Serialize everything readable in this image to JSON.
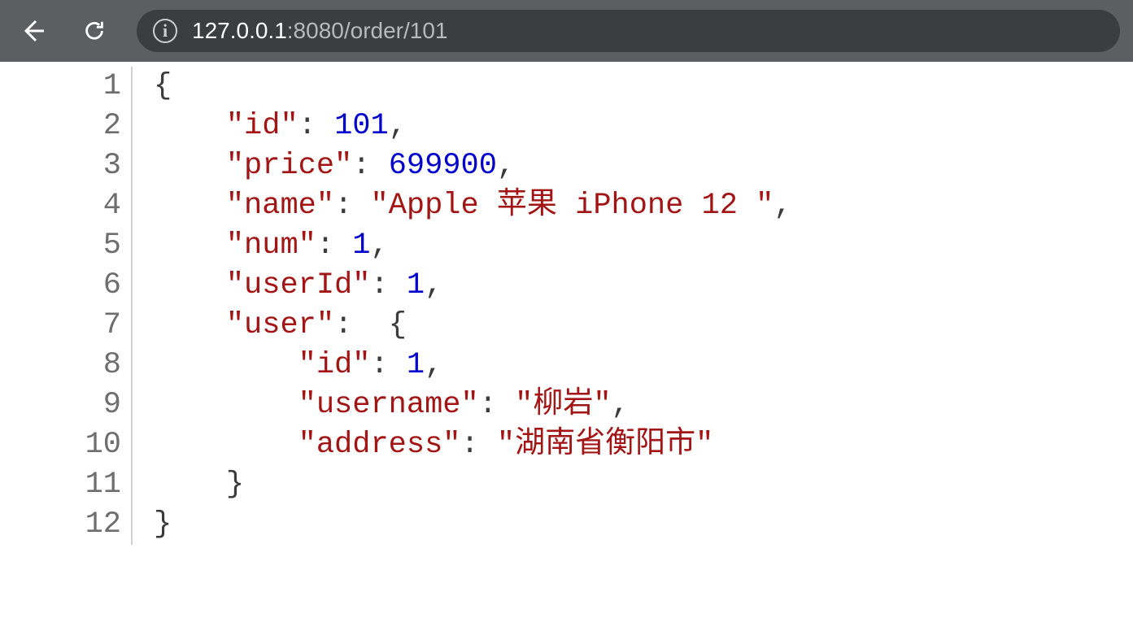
{
  "toolbar": {
    "back_label": "Back",
    "reload_label": "Reload",
    "info_label": "Site information",
    "url_host": "127.0.0.1",
    "url_port": ":8080",
    "url_path": "/order/101"
  },
  "json_body": {
    "id": 101,
    "price": 699900,
    "name": "Apple 苹果 iPhone 12 ",
    "num": 1,
    "userId": 1,
    "user": {
      "id": 1,
      "username": "柳岩",
      "address": "湖南省衡阳市"
    }
  },
  "code_lines": [
    {
      "num": "1",
      "indent": 0,
      "parts": [
        {
          "t": "p",
          "v": "{"
        }
      ]
    },
    {
      "num": "2",
      "indent": 1,
      "parts": [
        {
          "t": "k",
          "v": "\"id\""
        },
        {
          "t": "p",
          "v": ": "
        },
        {
          "t": "n",
          "v": "101"
        },
        {
          "t": "p",
          "v": ","
        }
      ]
    },
    {
      "num": "3",
      "indent": 1,
      "parts": [
        {
          "t": "k",
          "v": "\"price\""
        },
        {
          "t": "p",
          "v": ": "
        },
        {
          "t": "n",
          "v": "699900"
        },
        {
          "t": "p",
          "v": ","
        }
      ]
    },
    {
      "num": "4",
      "indent": 1,
      "parts": [
        {
          "t": "k",
          "v": "\"name\""
        },
        {
          "t": "p",
          "v": ": "
        },
        {
          "t": "k",
          "v": "\"Apple 苹果 iPhone 12 \""
        },
        {
          "t": "p",
          "v": ","
        }
      ]
    },
    {
      "num": "5",
      "indent": 1,
      "parts": [
        {
          "t": "k",
          "v": "\"num\""
        },
        {
          "t": "p",
          "v": ": "
        },
        {
          "t": "n",
          "v": "1"
        },
        {
          "t": "p",
          "v": ","
        }
      ]
    },
    {
      "num": "6",
      "indent": 1,
      "parts": [
        {
          "t": "k",
          "v": "\"userId\""
        },
        {
          "t": "p",
          "v": ": "
        },
        {
          "t": "n",
          "v": "1"
        },
        {
          "t": "p",
          "v": ","
        }
      ]
    },
    {
      "num": "7",
      "indent": 1,
      "parts": [
        {
          "t": "k",
          "v": "\"user\""
        },
        {
          "t": "p",
          "v": ": "
        },
        {
          "t": "p",
          "v": " {"
        }
      ]
    },
    {
      "num": "8",
      "indent": 2,
      "parts": [
        {
          "t": "k",
          "v": "\"id\""
        },
        {
          "t": "p",
          "v": ": "
        },
        {
          "t": "n",
          "v": "1"
        },
        {
          "t": "p",
          "v": ","
        }
      ]
    },
    {
      "num": "9",
      "indent": 2,
      "parts": [
        {
          "t": "k",
          "v": "\"username\""
        },
        {
          "t": "p",
          "v": ": "
        },
        {
          "t": "k",
          "v": "\"柳岩\""
        },
        {
          "t": "p",
          "v": ","
        }
      ]
    },
    {
      "num": "10",
      "indent": 2,
      "parts": [
        {
          "t": "k",
          "v": "\"address\""
        },
        {
          "t": "p",
          "v": ": "
        },
        {
          "t": "k",
          "v": "\"湖南省衡阳市\""
        }
      ]
    },
    {
      "num": "11",
      "indent": 1,
      "parts": [
        {
          "t": "p",
          "v": "}"
        }
      ]
    },
    {
      "num": "12",
      "indent": 0,
      "parts": [
        {
          "t": "p",
          "v": "}"
        }
      ]
    }
  ]
}
